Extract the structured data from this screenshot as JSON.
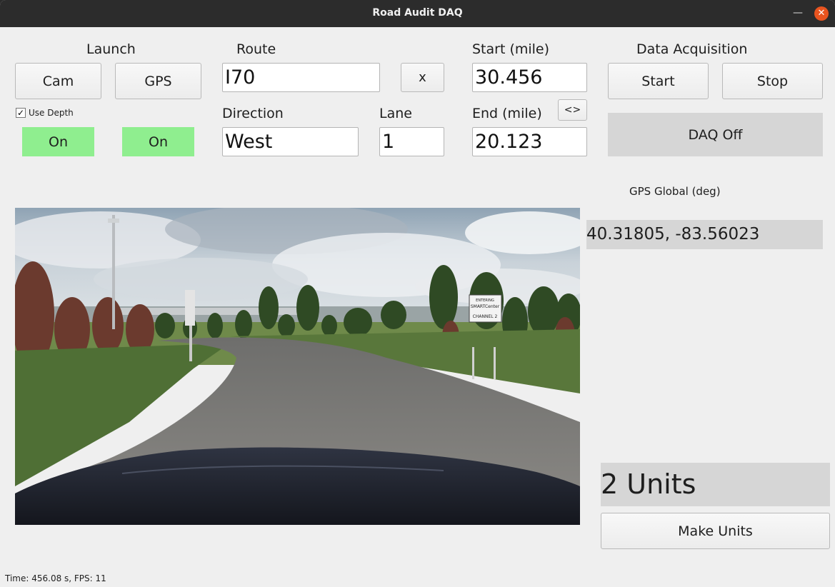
{
  "window": {
    "title": "Road Audit DAQ"
  },
  "launch": {
    "heading": "Launch",
    "cam_label": "Cam",
    "gps_label": "GPS",
    "use_depth_label": "Use Depth",
    "use_depth_checked": true,
    "cam_status": "On",
    "gps_status": "On",
    "status_color": "#8fee8f"
  },
  "route": {
    "heading": "Route",
    "value": "I70",
    "clear_label": "x",
    "direction_label": "Direction",
    "direction_value": "West",
    "lane_label": "Lane",
    "lane_value": "1"
  },
  "mileage": {
    "start_label": "Start (mile)",
    "start_value": "30.456",
    "swap_label": "<>",
    "end_label": "End (mile)",
    "end_value": "20.123"
  },
  "daq": {
    "heading": "Data Acquisition",
    "start_label": "Start",
    "stop_label": "Stop",
    "state": "DAQ Off"
  },
  "gps": {
    "heading": "GPS Global (deg)",
    "coords": "40.31805, -83.56023"
  },
  "units": {
    "count": "2 Units",
    "make_label": "Make Units"
  },
  "camera": {
    "sign_lines": [
      "ENTERING",
      "SMARTCenter",
      "CHANNEL 2"
    ]
  },
  "status": {
    "text": "Time: 456.08 s, FPS: 11"
  }
}
